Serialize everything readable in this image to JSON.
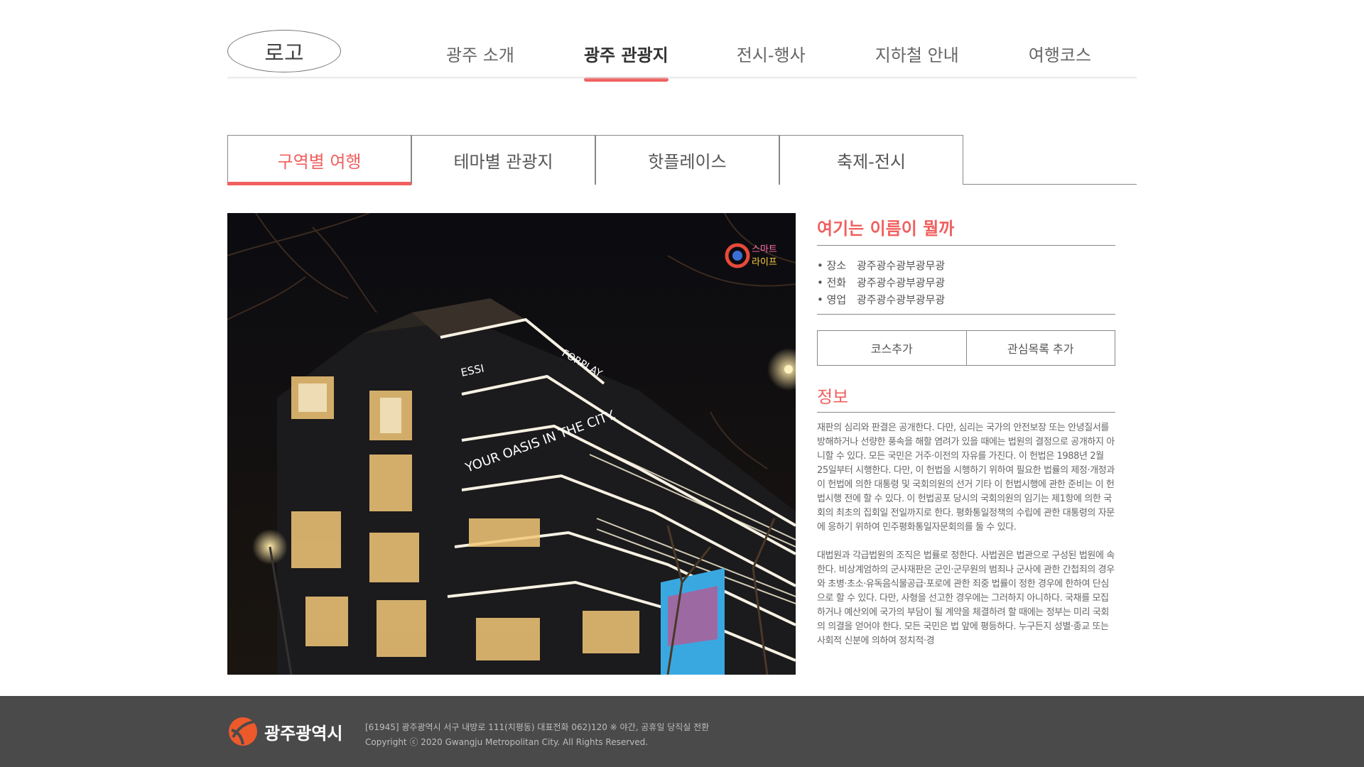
{
  "colors": {
    "accent": "#f0605f",
    "footer_bg": "#4a4a4a"
  },
  "header": {
    "logo": "로고",
    "nav": [
      "광주 소개",
      "광주 관광지",
      "전시-행사",
      "지하철 안내",
      "여행코스"
    ]
  },
  "tabs": [
    "구역별 여행",
    "테마별 관광지",
    "핫플레이스",
    "축제-전시"
  ],
  "photo": {
    "building_signs": [
      "FORPLAY",
      "YOUR OASIS IN THE CITY.",
      "ESSI"
    ],
    "badge": [
      "스마트",
      "라이프"
    ]
  },
  "panel": {
    "title": "여기는 이름이 뭘까",
    "meta": [
      {
        "key": "• 장소",
        "value": "광주광수광부광무광"
      },
      {
        "key": "• 전화",
        "value": "광주광수광부광무광"
      },
      {
        "key": "• 영업",
        "value": "광주광수광부광무광"
      }
    ],
    "buttons": [
      "코스추가",
      "관심목록 추가"
    ],
    "info_title": "정보",
    "paragraphs": [
      "재판의 심리와 판결은 공개한다. 다만, 심리는 국가의 안전보장 또는 안녕질서를 방해하거나 선량한 풍속을 해할 염려가 있을 때에는 법원의 결정으로 공개하지 아니할 수 있다. 모든 국민은 거주·이전의 자유를 가진다. 이 헌법은 1988년 2월 25일부터 시행한다. 다만, 이 헌법을 시행하기 위하여 필요한 법률의 제정·개정과 이 헌법에 의한 대통령 및 국회의원의 선거 기타 이 헌법시행에 관한 준비는 이 헌법시행 전에 할 수 있다. 이 헌법공포 당시의 국회의원의 임기는 제1항에 의한 국회의 최초의 집회일 전일까지로 한다. 평화통일정책의 수립에 관한 대통령의 자문에 응하기 위하여 민주평화통일자문회의를 둘 수 있다.",
      "대법원과 각급법원의 조직은 법률로 정한다. 사법권은 법관으로 구성된 법원에 속한다. 비상계엄하의 군사재판은 군인·군무원의 범죄나 군사에 관한 간첩죄의 경우와 초병·초소·유독음식물공급·포로에 관한 죄중 법률이 정한 경우에 한하여 단심으로 할 수 있다. 다만, 사형을 선고한 경우에는 그러하지 아니하다. 국채를 모집하거나 예산외에 국가의 부담이 될 계약을 체결하려 할 때에는 정부는 미리 국회의 의결을 얻어야 한다. 모든 국민은 법 앞에 평등하다. 누구든지 성별·종교 또는 사회적 신분에 의하여 정치적·경"
    ]
  },
  "footer": {
    "logo_name": "광주광역시",
    "address": "[61945] 광주광역시 서구 내방로 111(치평동) 대표전화 062)120 ※ 야간, 공휴일 당직실 전환",
    "copyright": "Copyright ⓒ 2020 Gwangju Metropolitan City. All Rights Reserved."
  }
}
